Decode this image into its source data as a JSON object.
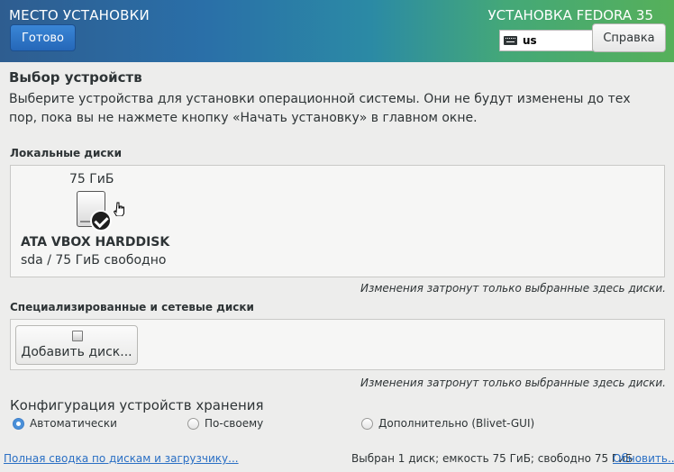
{
  "header": {
    "title": "МЕСТО УСТАНОВКИ",
    "product": "УСТАНОВКА FEDORA 35",
    "done_label": "Готово",
    "keyboard_layout": "us",
    "help_label": "Справка"
  },
  "devices": {
    "title": "Выбор устройств",
    "description": "Выберите устройства для установки операционной системы. Они не будут изменены до тех пор, пока вы не нажмете кнопку «Начать установку» в главном окне.",
    "local_label": "Локальные диски",
    "disk": {
      "size": "75 ГиБ",
      "name": "ATA VBOX HARDDISK",
      "free": "sda  /  75 ГиБ свободно",
      "selected": true
    },
    "local_note": "Изменения затронут только выбранные здесь диски.",
    "special_label": "Специализированные и сетевые диски",
    "add_disk_label": "Добавить диск...",
    "special_note": "Изменения затронут только выбранные здесь диски."
  },
  "storage": {
    "title": "Конфигурация устройств хранения",
    "options": [
      {
        "label": "Автоматически",
        "selected": true
      },
      {
        "label": "По-своему",
        "selected": false
      },
      {
        "label": "Дополнительно (Blivet-GUI)",
        "selected": false
      }
    ]
  },
  "footer": {
    "summary_link": "Полная сводка по дискам и загрузчику...",
    "status": "Выбран 1 диск; емкость 75 ГиБ; свободно 75 ГиБ",
    "refresh_link": "Обновить..."
  }
}
